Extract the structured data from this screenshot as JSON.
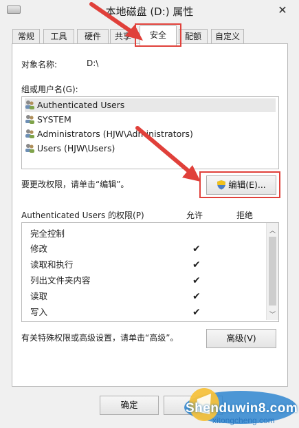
{
  "window": {
    "title": "本地磁盘 (D:) 属性",
    "close_glyph": "✕"
  },
  "tabs": [
    {
      "label": "常规"
    },
    {
      "label": "工具"
    },
    {
      "label": "硬件"
    },
    {
      "label": "共享"
    },
    {
      "label": "安全"
    },
    {
      "label": "配额"
    },
    {
      "label": "自定义"
    }
  ],
  "active_tab": "安全",
  "security": {
    "object_name_label": "对象名称:",
    "object_name_value": "D:\\",
    "group_label": "组或用户名(G):",
    "users": [
      {
        "name": "Authenticated Users",
        "icon": "users-group-icon"
      },
      {
        "name": "SYSTEM",
        "icon": "users-group-icon"
      },
      {
        "name": "Administrators (HJW\\Administrators)",
        "icon": "users-group-icon"
      },
      {
        "name": "Users (HJW\\Users)",
        "icon": "users-group-icon"
      }
    ],
    "change_perm_text": "要更改权限，请单击“编辑”。",
    "edit_button": "编辑(E)...",
    "perm_header": "Authenticated Users 的权限(P)",
    "allow_header": "允许",
    "deny_header": "拒绝",
    "permissions": [
      {
        "name": "完全控制",
        "allow": ""
      },
      {
        "name": "修改",
        "allow": "✔"
      },
      {
        "name": "读取和执行",
        "allow": "✔"
      },
      {
        "name": "列出文件夹内容",
        "allow": "✔"
      },
      {
        "name": "读取",
        "allow": "✔"
      },
      {
        "name": "写入",
        "allow": "✔"
      }
    ],
    "advanced_text": "有关特殊权限或高级设置，请单击“高级”。",
    "advanced_button": "高级(V)"
  },
  "footer": {
    "ok_button": "确定",
    "cancel_button": "取"
  },
  "watermark": {
    "line1": "Shenduwin8.com",
    "line2": "xitongcheng.com"
  },
  "colors": {
    "annotation_red": "#e0403a",
    "selected_row": "#e8e8e8"
  }
}
